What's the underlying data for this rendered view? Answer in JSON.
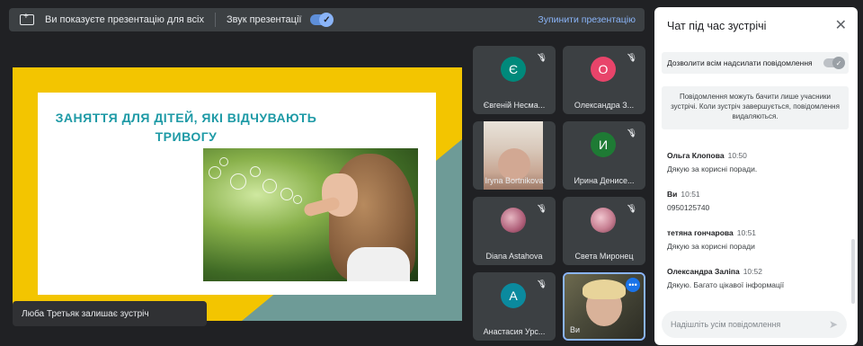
{
  "present_bar": {
    "message": "Ви показуєте презентацію для всіх",
    "sound_label": "Звук презентації",
    "stop_label": "Зупинити презентацію"
  },
  "slide": {
    "title_line1": "ЗАНЯТТЯ ДЛЯ ДІТЕЙ, ЯКІ ВІДЧУВАЮТЬ",
    "title_line2": "ТРИВОГУ"
  },
  "toast": "Люба Третьяк залишає зустріч",
  "participants": [
    {
      "name": "Євгеній Несма...",
      "initial": "Є",
      "color": "#00897b"
    },
    {
      "name": "Олександра З...",
      "initial": "О",
      "color": "#e8446a"
    },
    {
      "name": "Iryna Bortnikova",
      "initial": "",
      "color": ""
    },
    {
      "name": "Ирина Денисе...",
      "initial": "И",
      "color": "#1e7a34"
    },
    {
      "name": "Diana Astahova",
      "initial": "",
      "color": ""
    },
    {
      "name": "Света Миронец",
      "initial": "",
      "color": ""
    },
    {
      "name": "Анастасия Урс...",
      "initial": "А",
      "color": "#0b8a9e"
    },
    {
      "name": "Ви",
      "initial": "",
      "color": ""
    }
  ],
  "chat": {
    "title": "Чат під час зустрічі",
    "allow_label": "Дозволити всім надсилати повідомлення",
    "notice": "Повідомлення можуть бачити лише учасники зустрічі. Коли зустріч завершується, повідомлення видаляються.",
    "messages": [
      {
        "author": "Ольга Клопова",
        "time": "10:50",
        "text": "Дякую за корисні поради."
      },
      {
        "author": "Ви",
        "time": "10:51",
        "text": "0950125740"
      },
      {
        "author": "тетяна гончарова",
        "time": "10:51",
        "text": "Дякую за корисні поради"
      },
      {
        "author": "Олександра Заліпа",
        "time": "10:52",
        "text": "Дякую. Багато цікавої інформації"
      }
    ],
    "input_placeholder": "Надішліть усім повідомлення"
  }
}
